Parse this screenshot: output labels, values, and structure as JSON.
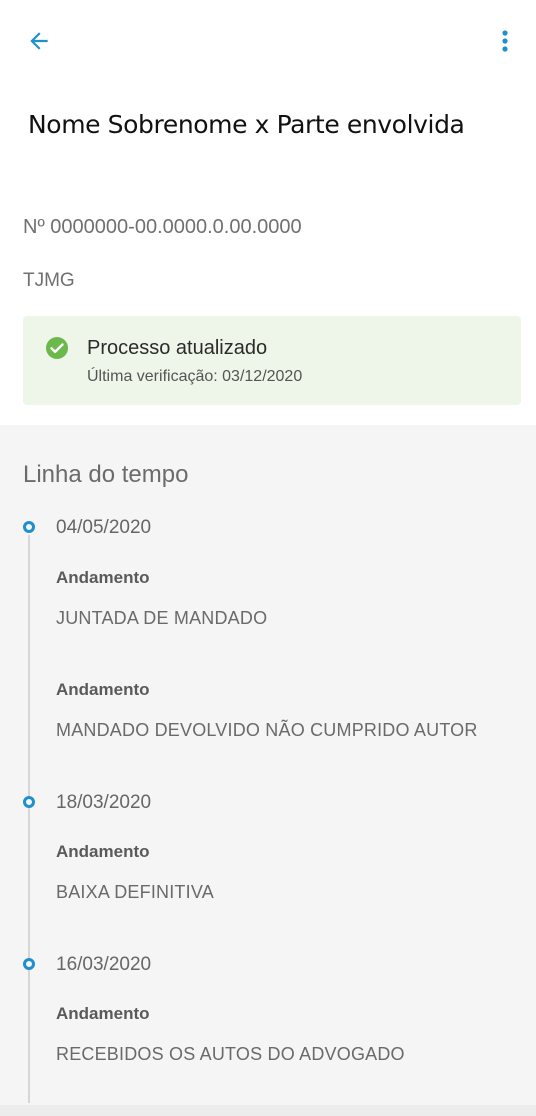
{
  "header": {
    "back_icon": "arrow-left-icon",
    "more_icon": "more-vertical-icon",
    "title": "Nome Sobrenome x Parte envolvida"
  },
  "process": {
    "number": "Nº 0000000-00.0000.0.00.0000",
    "court": "TJMG"
  },
  "status": {
    "icon": "check-circle-icon",
    "title": "Processo atualizado",
    "subtitle": "Última verificação: 03/12/2020"
  },
  "timeline": {
    "title": "Linha do tempo",
    "entries": [
      {
        "date": "04/05/2020",
        "events": [
          {
            "label": "Andamento",
            "text": "JUNTADA DE MANDADO"
          },
          {
            "label": "Andamento",
            "text": "MANDADO DEVOLVIDO NÃO CUMPRIDO AUTOR"
          }
        ]
      },
      {
        "date": "18/03/2020",
        "events": [
          {
            "label": "Andamento",
            "text": "BAIXA DEFINITIVA"
          }
        ]
      },
      {
        "date": "16/03/2020",
        "events": [
          {
            "label": "Andamento",
            "text": "RECEBIDOS OS AUTOS DO ADVOGADO"
          }
        ]
      }
    ]
  },
  "colors": {
    "accent": "#1e8fcf",
    "success": "#6bb84b",
    "status_bg": "#eef5e9",
    "timeline_bg": "#f5f5f5"
  }
}
